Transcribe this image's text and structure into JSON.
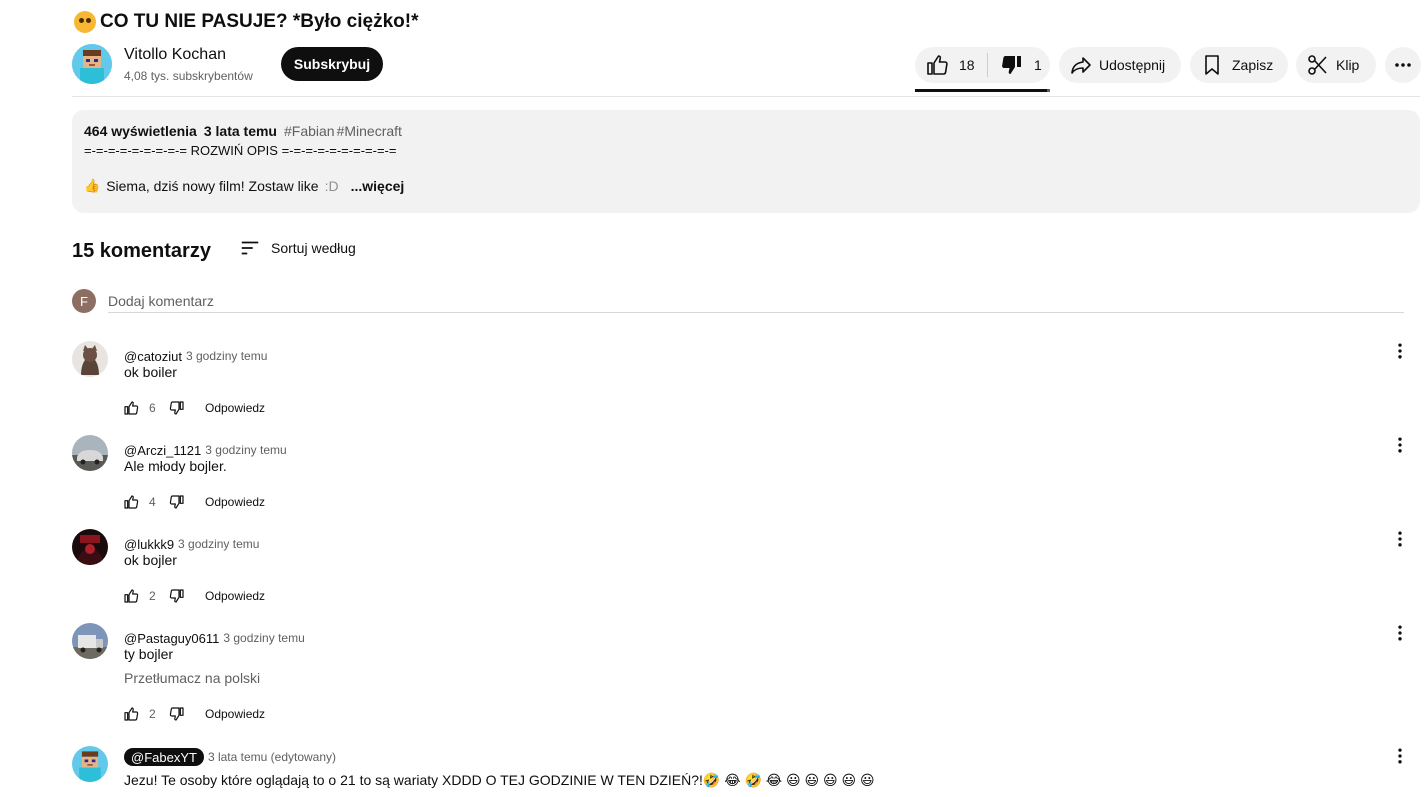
{
  "video": {
    "title": "CO TU NIE PASUJE? *Było ciężko!*",
    "title_emoji_icon": "face-with-monocle-emoji"
  },
  "channel": {
    "name": "Vitollo Kochan",
    "subscribers": "4,08 tys. subskrybentów",
    "subscribe_label": "Subskrybuj"
  },
  "actions": {
    "likes": "18",
    "dislikes": "1",
    "share_label": "Udostępnij",
    "save_label": "Zapisz",
    "clip_label": "Klip"
  },
  "description": {
    "views": "464 wyświetlenia",
    "age": "3 lata temu",
    "tags": [
      "#Fabian",
      "#Minecraft"
    ],
    "line2": "=-=-=-=-=-=-=-=-= ROZWIŃ OPIS =-=-=-=-=-=-=-=-=-=",
    "line3": "Siema, dziś nowy film! Zostaw like",
    "line3_suffix": ":D",
    "more_label": "...więcej"
  },
  "comments_section": {
    "count_label": "15 komentarzy",
    "sort_label": "Sortuj według",
    "add_placeholder": "Dodaj komentarz",
    "my_avatar_letter": "F"
  },
  "comments": [
    {
      "author": "@catoziut",
      "time": "3 godziny temu",
      "text": "ok boiler",
      "likes": "6",
      "reply_label": "Odpowiedz"
    },
    {
      "author": "@Arczi_1121",
      "time": "3 godziny temu",
      "text": "Ale młody bojler.",
      "likes": "4",
      "reply_label": "Odpowiedz"
    },
    {
      "author": "@lukkk9",
      "time": "3 godziny temu",
      "text": "ok bojler",
      "likes": "2",
      "reply_label": "Odpowiedz"
    },
    {
      "author": "@Pastaguy0611",
      "time": "3 godziny temu",
      "text": "ty bojler",
      "translate_label": "Przetłumacz na polski",
      "likes": "2",
      "reply_label": "Odpowiedz"
    },
    {
      "author": "@FabexYT",
      "time": "3 lata temu (edytowany)",
      "text": "Jezu! Te osoby które oglądają to o 21 to są wariaty XDDD O TEJ GODZINIE W TEN DZIEŃ?!🤣 😂 🤣 😂 😃 😃 😃 😃 😃"
    }
  ]
}
